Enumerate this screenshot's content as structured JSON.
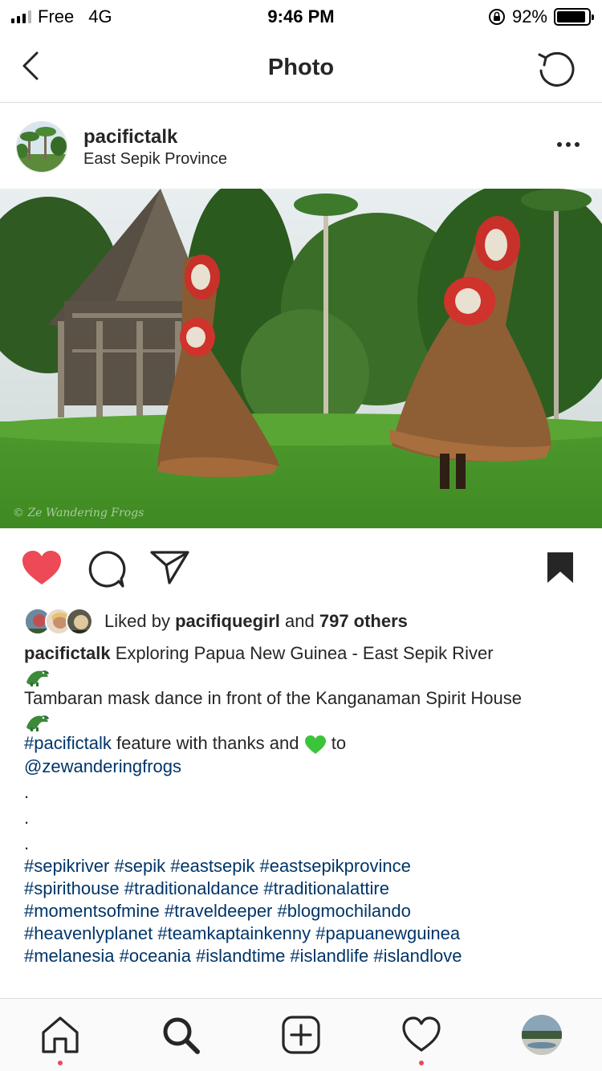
{
  "status_bar": {
    "carrier": "Free",
    "network": "4G",
    "time": "9:46 PM",
    "battery": "92%",
    "battery_level": 0.92
  },
  "nav": {
    "title": "Photo",
    "back_icon": "chevron-left-icon",
    "right_icon": "refresh-icon"
  },
  "post": {
    "username": "pacifictalk",
    "location": "East Sepik Province",
    "more_icon": "more-dots-icon",
    "photo_watermark": "© Ze Wandering Frogs",
    "liked": true,
    "like_color": "#ed4956"
  },
  "likes": {
    "prefix": "Liked by",
    "top_liker": "pacifiquegirl",
    "joiner": "and",
    "others": "797 others"
  },
  "caption": {
    "username": "pacifictalk",
    "line1": "Exploring Papua New Guinea - East Sepik River",
    "line2": "Tambaran mask dance in front of the Kanganaman Spirit House",
    "hashtag": "#pacifictalk",
    "feature_text": "feature with thanks and",
    "to_text": "to",
    "mention": "@zewanderingfrogs",
    "dot": ".",
    "hashtag_lines": [
      "#sepikriver #sepik #eastsepik #eastsepikprovince",
      "#spirithouse #traditionaldance #traditionalattire",
      "#momentsofmine #traveldeeper #blogmochilando",
      "#heavenlyplanet #teamkaptainkenny #papuanewguinea",
      "#melanesia #oceania #islandtime #islandlife #islandlove"
    ]
  },
  "tab_bar": {
    "items": [
      "home-icon",
      "search-icon",
      "new-post-icon",
      "activity-heart-icon",
      "profile-avatar"
    ],
    "notification_color": "#ed4956"
  }
}
